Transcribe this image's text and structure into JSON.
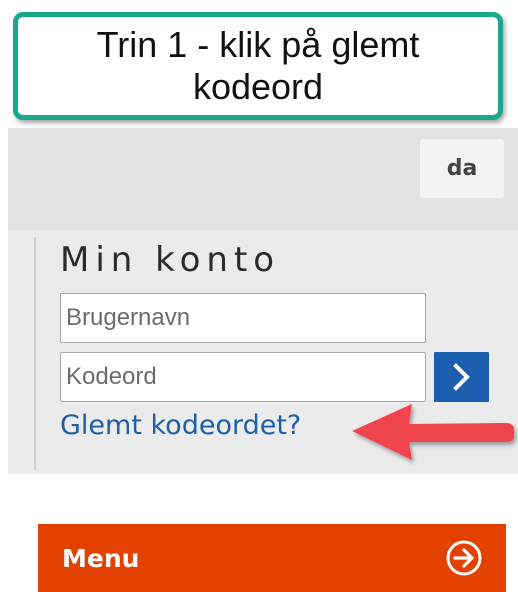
{
  "callout": {
    "text": "Trin 1 - klik på glemt kodeord",
    "border_color": "#1aa88a"
  },
  "header": {
    "language_button": "da"
  },
  "login": {
    "title": "Min konto",
    "username_placeholder": "Brugernavn",
    "password_placeholder": "Kodeord",
    "submit_icon": "chevron-right-icon",
    "forgot_password_link": "Glemt kodeordet?",
    "accent_color": "#1b5fae"
  },
  "annotation": {
    "arrow_icon": "arrow-left-icon",
    "color": "#f0444f"
  },
  "menu": {
    "label": "Menu",
    "icon": "circle-arrow-right-icon",
    "color": "#e24100"
  }
}
